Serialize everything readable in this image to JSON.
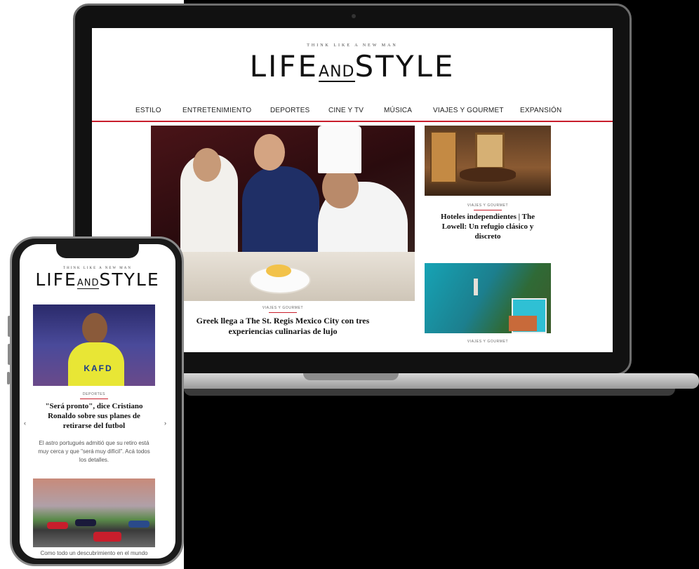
{
  "site": {
    "tagline": "THINK LIKE A NEW MAN",
    "logo_left": "LIFE",
    "logo_and": "AND",
    "logo_right": "STYLE"
  },
  "nav": {
    "items": [
      "ESTILO",
      "ENTRETENIMIENTO",
      "DEPORTES",
      "CINE Y TV",
      "MÚSICA",
      "VIAJES Y GOURMET",
      "EXPANSIÓN"
    ]
  },
  "hero": {
    "kicker": "VIAJES Y GOURMET",
    "title": "Greek llega a The St. Regis Mexico City con tres experiencias culinarias de lujo"
  },
  "side_articles": [
    {
      "kicker": "VIAJES Y GOURMET",
      "title": "Hoteles independientes | The Lowell: Un refugio clásico y discreto"
    },
    {
      "kicker": "VIAJES Y GOURMET",
      "title": ""
    }
  ],
  "phone": {
    "tagline": "THINK LIKE A NEW MAN",
    "logo_left": "LIFE",
    "logo_and": "AND",
    "logo_right": "STYLE",
    "jersey_text": "KAFD",
    "article1": {
      "kicker": "DEPORTES",
      "title": "\"Será pronto\", dice Cristiano Ronaldo sobre sus planes de retirarse del futbol",
      "description": "El astro portugués admitió que su retiro está muy cerca y que \"será muy difícil\". Acá todos los detalles."
    },
    "bottom_text": "Como todo un descubrimiento en el mundo",
    "prev_arrow": "‹",
    "next_arrow": "›"
  },
  "colors": {
    "accent": "#c81e2c"
  }
}
